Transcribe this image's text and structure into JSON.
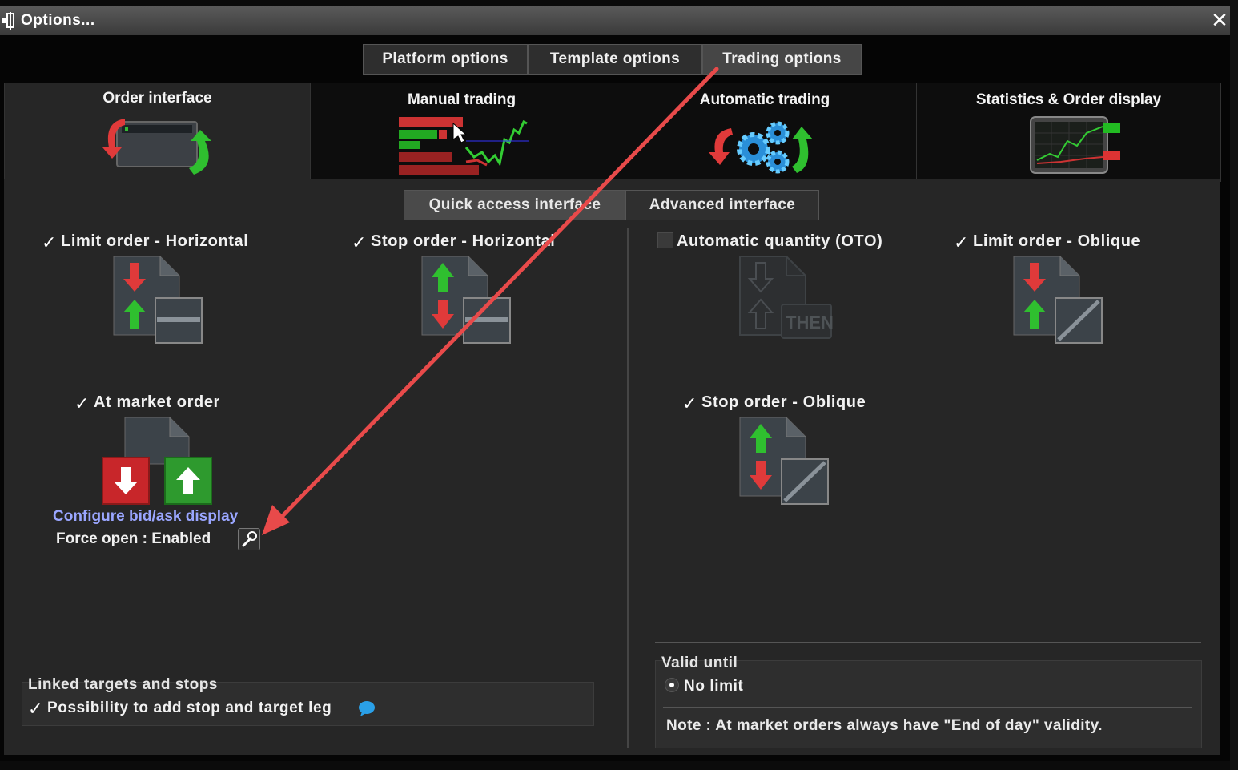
{
  "window": {
    "title": "Options...",
    "close_glyph": "✕"
  },
  "top_tabs": [
    {
      "label": "Platform options",
      "active": false
    },
    {
      "label": "Template options",
      "active": false
    },
    {
      "label": "Trading options",
      "active": true
    }
  ],
  "category_tabs": [
    {
      "label": "Order interface",
      "icon": "order-interface-icon",
      "active": true
    },
    {
      "label": "Manual trading",
      "icon": "manual-trading-icon",
      "active": false
    },
    {
      "label": "Automatic trading",
      "icon": "automatic-trading-icon",
      "active": false
    },
    {
      "label": "Statistics & Order display",
      "icon": "statistics-icon",
      "active": false
    }
  ],
  "sub_tabs": [
    {
      "label": "Quick access interface",
      "active": true
    },
    {
      "label": "Advanced interface",
      "active": false
    }
  ],
  "options": {
    "limit_horizontal": {
      "label": "Limit order - Horizontal",
      "checked": true
    },
    "stop_horizontal": {
      "label": "Stop order - Horizontal",
      "checked": true
    },
    "at_market": {
      "label": "At market order",
      "checked": true
    },
    "automatic_quantity": {
      "label": "Automatic quantity (OTO)",
      "checked": false,
      "icon_text": "THEN"
    },
    "limit_oblique": {
      "label": "Limit order - Oblique",
      "checked": true
    },
    "stop_oblique": {
      "label": "Stop order - Oblique",
      "checked": true
    }
  },
  "configure_link": "Configure bid/ask display",
  "force_open": "Force open : Enabled",
  "linked": {
    "title": "Linked targets and stops",
    "option_label": "Possibility to add stop and target leg",
    "checked": true
  },
  "valid_until": {
    "title": "Valid until",
    "radio_label": "No limit",
    "note": "Note : At market orders always have \"End of day\" validity."
  },
  "colors": {
    "accent_red": "#e03a3a",
    "accent_green": "#2fbf2f",
    "link": "#9aa6ff",
    "arrow": "#e84a4a"
  }
}
